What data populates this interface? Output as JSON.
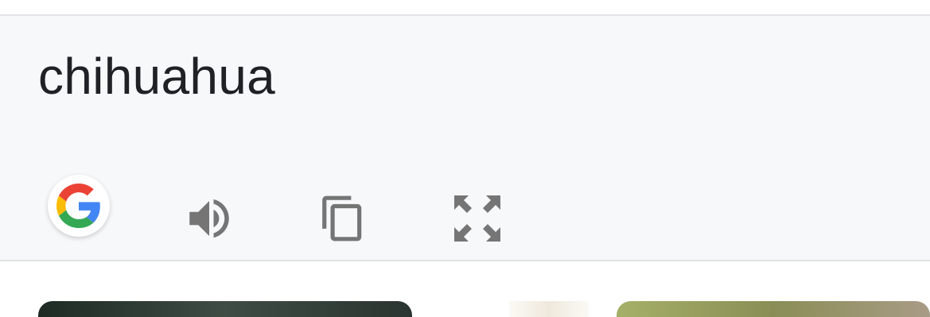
{
  "search": {
    "query": "chihuahua"
  },
  "actions": {
    "google_icon": "google-g-icon",
    "listen_icon": "speaker-icon",
    "copy_icon": "copy-icon",
    "fullscreen_icon": "fullscreen-icon"
  },
  "colors": {
    "card_background": "#f7f8fa",
    "divider": "#e1e3e6",
    "icon_gray": "#757575",
    "text": "#202124",
    "google_blue": "#4285F4",
    "google_red": "#EA4335",
    "google_yellow": "#FBBC05",
    "google_green": "#34A853"
  }
}
